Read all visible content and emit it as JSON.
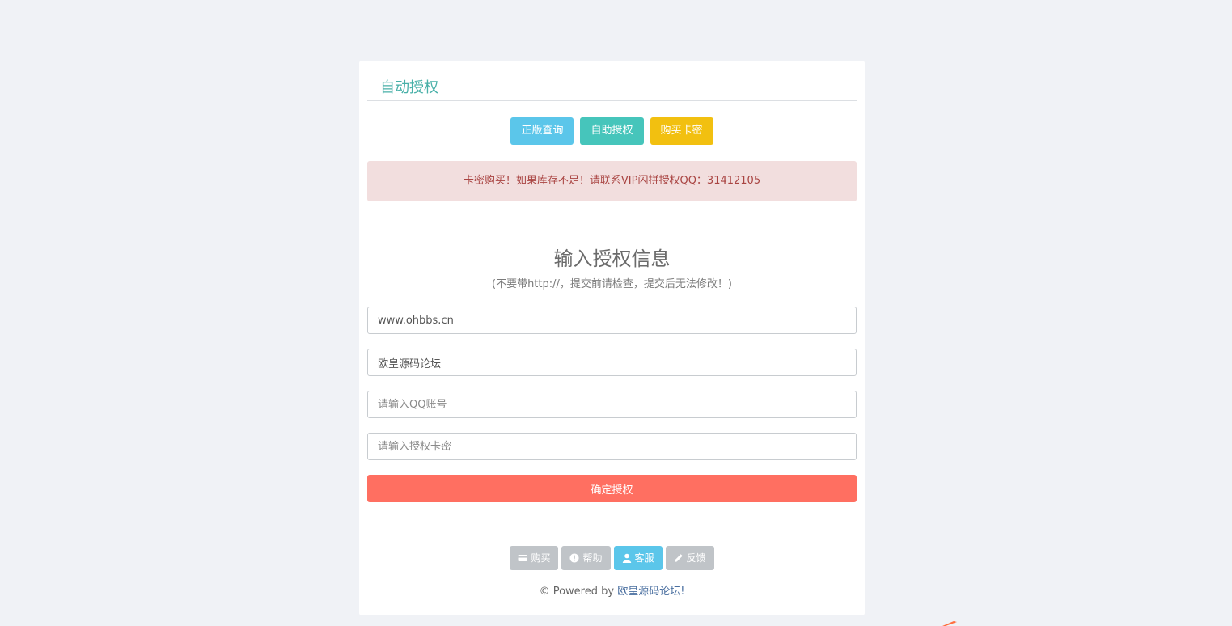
{
  "panel": {
    "title": "自动授权"
  },
  "top_buttons": {
    "query": "正版查询",
    "self_auth": "自助授权",
    "buy_card": "购买卡密"
  },
  "alert": {
    "text": "卡密购买！如果库存不足！请联系VIP闪拼授权QQ：31412105"
  },
  "form": {
    "title": "输入授权信息",
    "subtitle": "(不要带http://，提交前请检查，提交后无法修改！)",
    "domain_value": "www.ohbbs.cn",
    "name_value": "欧皇源码论坛",
    "qq_placeholder": "请输入QQ账号",
    "card_placeholder": "请输入授权卡密",
    "submit_label": "确定授权"
  },
  "footer_buttons": [
    {
      "label": "购买",
      "icon": "credit-card-icon"
    },
    {
      "label": "帮助",
      "icon": "exclamation-circle-icon"
    },
    {
      "label": "客服",
      "icon": "user-icon"
    },
    {
      "label": "反馈",
      "icon": "pencil-icon"
    }
  ],
  "footer": {
    "prefix": "© Powered by ",
    "link": "欧皇源码论坛!"
  },
  "colors": {
    "background": "#f0f2f6",
    "title_teal": "#48b0a8",
    "btn_info": "#5bc6ea",
    "btn_teal": "#46c5bb",
    "btn_warn": "#f2c010",
    "alert_bg": "#f2dede",
    "alert_text": "#a94442",
    "submit": "#ff6f61",
    "footer_btn": "#c0c4c8"
  }
}
